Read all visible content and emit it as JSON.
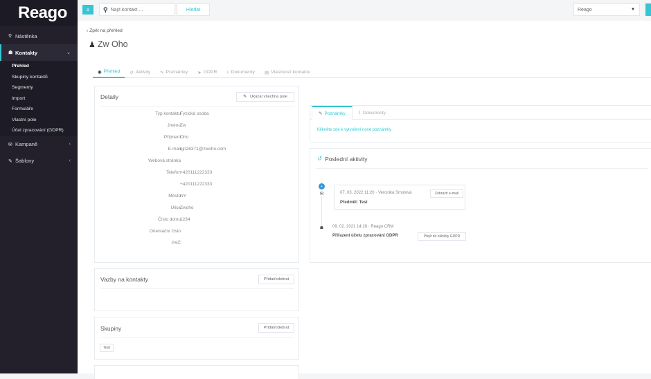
{
  "app": {
    "logo": "Reago"
  },
  "sidebar": {
    "dashboard": {
      "icon": "tachometer-icon",
      "label": "Nástěnka"
    },
    "contacts": {
      "icon": "users-icon",
      "label": "Kontakty"
    },
    "contacts_sub": [
      "Přehled",
      "Skupiny kontaktů",
      "Segmenty",
      "Import",
      "Formuláře",
      "Vlastní pole",
      "Účel zpracování (GDPR)"
    ],
    "campaigns": {
      "icon": "envelope-icon",
      "label": "Kampaně"
    },
    "templates": {
      "icon": "pencil-icon",
      "label": "Šablony"
    }
  },
  "topbar": {
    "search_placeholder": "Najít kontakt ...",
    "search_button": "Hledat",
    "org_selected": "Reago"
  },
  "contact": {
    "back_label": "‹ Zpět na přehled",
    "name": "Zw Oho"
  },
  "tabs": {
    "overview": "Přehled",
    "activities": "Aktivity",
    "notes": "Poznámky",
    "gdpr": "GDPR",
    "documents": "Dokumenty",
    "properties": "Vlastnosti kontaktu"
  },
  "details": {
    "title": "Detaily",
    "show_all_button": "Ukázat všechna pole",
    "rows": [
      {
        "label": "Typ kontaktu",
        "value": "Fyzická osoba"
      },
      {
        "label": "Jméno",
        "value": "Zw"
      },
      {
        "label": "Příjmení",
        "value": "Oho"
      },
      {
        "label": "E-mail",
        "value": "qjn26371@zwoho.com"
      },
      {
        "label": "Webová stránka",
        "value": ""
      },
      {
        "label": "Telefon",
        "value": "+420111222333"
      },
      {
        "label": "",
        "value": "+420111222333"
      },
      {
        "label": "Město",
        "value": "NY"
      },
      {
        "label": "Ulice",
        "value": "Zwoho"
      },
      {
        "label": "Číslo domu",
        "value": "1234"
      },
      {
        "label": "Orientační číslo",
        "value": ""
      },
      {
        "label": "PSČ",
        "value": ""
      }
    ]
  },
  "relations": {
    "title": "Vazby na kontakty",
    "button": "Přidat/odebrat"
  },
  "groups": {
    "title": "Skupiny",
    "button": "Přidat/odebrat",
    "chip": "Test"
  },
  "notes_panel": {
    "tab_notes": "Poznámky",
    "tab_documents": "Dokumenty",
    "create_link": "Klikněte zde k vytvoření nové poznámky"
  },
  "activities": {
    "title": "Poslední aktivity",
    "items": [
      {
        "date": "07. 03. 2022 11:20",
        "author": "Veronika Smolová",
        "button": "Zobrazit e-mail",
        "subject": "Předmět: Test"
      },
      {
        "date": "09. 02. 2021 14:28",
        "author": "Reago CRM",
        "text": "Přiřazení účelu zpracování GDPR",
        "button": "Přejít do záložky GDPR"
      }
    ]
  },
  "colors": {
    "accent": "#36c6d3",
    "sidebar": "#23202c"
  }
}
